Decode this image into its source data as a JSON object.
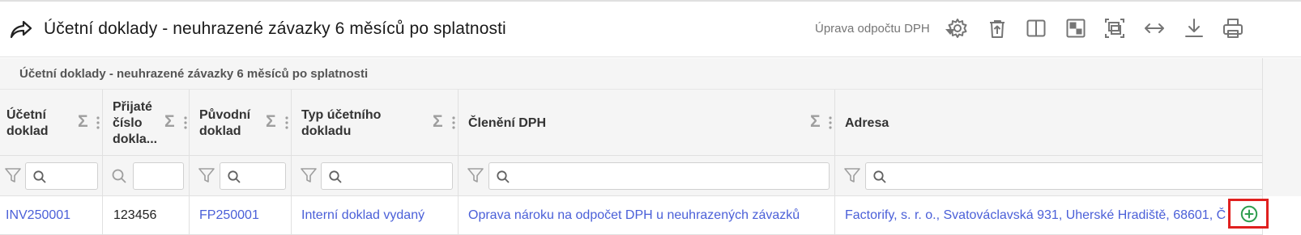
{
  "header": {
    "title": "Účetní doklady - neuhrazené závazky 6 měsíců po splatnosti",
    "action_select": "Úprava odpočtu DPH",
    "toolbar_icons": [
      "settings-icon",
      "archive-delete-icon",
      "split-view-icon",
      "layout-quadrant-icon",
      "fit-frame-icon",
      "expand-width-icon",
      "download-icon",
      "print-icon"
    ]
  },
  "grid": {
    "group_title": "Účetní doklady - neuhrazené závazky 6 měsíců po splatnosti",
    "columns": [
      {
        "label_lines": [
          "Účetní",
          "doklad"
        ]
      },
      {
        "label_lines": [
          "Přijaté",
          "číslo",
          "dokla..."
        ]
      },
      {
        "label_lines": [
          "Původní",
          "doklad"
        ]
      },
      {
        "label_lines": [
          "Typ účetního",
          "dokladu"
        ]
      },
      {
        "label_lines": [
          "Členění DPH"
        ]
      },
      {
        "label_lines": [
          "Adresa"
        ]
      }
    ],
    "rows": [
      {
        "ucetni_doklad": "INV250001",
        "prijate_cislo": "123456",
        "puvodni_doklad": "FP250001",
        "typ": "Interní doklad vydaný",
        "cleneni_dph": "Oprava nároku na odpočet DPH u neuhrazených závazků",
        "adresa": "Factorify, s. r. o., Svatováclavská 931, Uherské Hradiště, 68601, Č"
      }
    ]
  },
  "colors": {
    "link": "#4a5fd8",
    "highlight": "#e0201f",
    "add_icon": "#2e9e4f"
  }
}
